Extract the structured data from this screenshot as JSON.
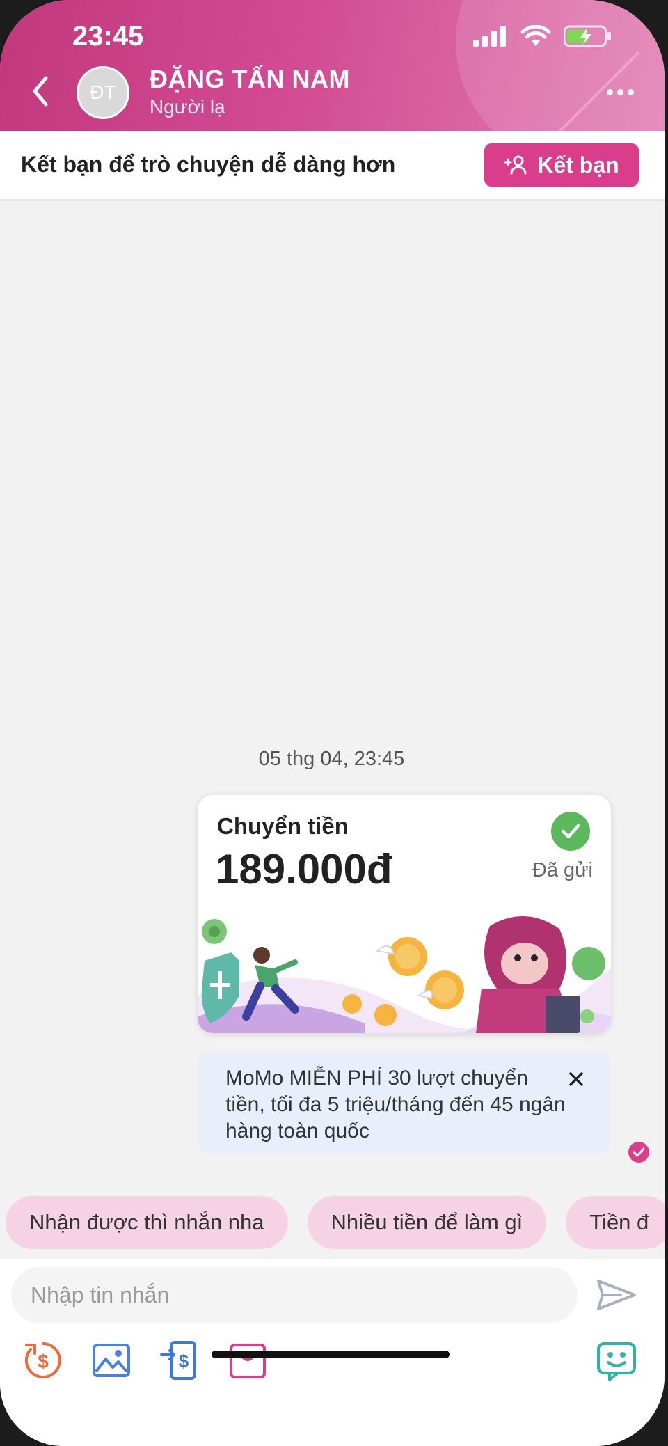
{
  "status_bar": {
    "time": "23:45"
  },
  "header": {
    "avatar_initials": "ĐT",
    "contact_name": "ĐẶNG TẤN NAM",
    "contact_subtitle": "Người lạ"
  },
  "friend_bar": {
    "prompt": "Kết bạn để trò chuyện dễ dàng hơn",
    "button_label": "Kết bạn"
  },
  "chat": {
    "timestamp": "05 thg 04, 23:45",
    "transfer": {
      "title": "Chuyển tiền",
      "amount": "189.000đ",
      "status": "Đã gửi"
    },
    "promo": "MoMo MIỄN PHÍ 30 lượt chuyển tiền, tối đa 5 triệu/tháng đến 45 ngân hàng toàn quốc"
  },
  "quick_replies": [
    "Nhận được thì nhắn nha",
    "Nhiều tiền để làm gì",
    "Tiền đ"
  ],
  "composer": {
    "placeholder": "Nhập tin nhắn"
  },
  "colors": {
    "brand": "#d93d8b",
    "success": "#5cb85c",
    "chip": "#f6d3e4"
  }
}
